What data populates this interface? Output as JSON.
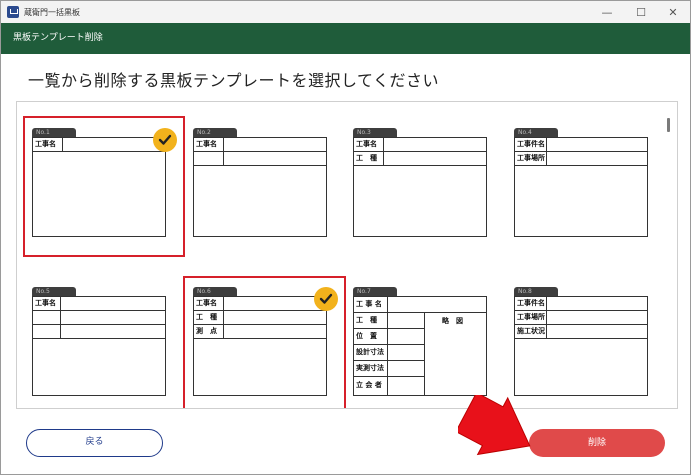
{
  "window": {
    "title": "蔵衛門一括黒板",
    "controls": [
      "—",
      "☐",
      "✕"
    ]
  },
  "header": {
    "title": "黒板テンプレート削除"
  },
  "main": {
    "heading": "一覧から削除する黒板テンプレートを選択してください"
  },
  "templates": [
    {
      "no": "No.1",
      "selected": true,
      "rows": [
        "工事名"
      ]
    },
    {
      "no": "No.2",
      "selected": false,
      "rows": [
        "工事名"
      ]
    },
    {
      "no": "No.3",
      "selected": false,
      "rows": [
        "工事名",
        "工　種"
      ]
    },
    {
      "no": "No.4",
      "selected": false,
      "rows": [
        "工事件名",
        "工事場所"
      ]
    },
    {
      "no": "No.5",
      "selected": false,
      "rows": [
        "工事名"
      ]
    },
    {
      "no": "No.6",
      "selected": true,
      "rows": [
        "工事名",
        "工　種",
        "測　点"
      ]
    },
    {
      "no": "No.7",
      "selected": false,
      "rows": [
        "工 事 名",
        "工　種",
        "位　置",
        "設計寸法",
        "実測寸法",
        "立 会 者"
      ],
      "figure_label": "略　図"
    },
    {
      "no": "No.8",
      "selected": false,
      "rows": [
        "工事件名",
        "工事場所",
        "施工状況"
      ]
    }
  ],
  "footer": {
    "back_label": "戻る",
    "delete_label": "削除"
  },
  "colors": {
    "header_green": "#1f5c3a",
    "select_red": "#d6202a",
    "check_yellow": "#f2b21c",
    "delete_red": "#e04a4a",
    "back_blue": "#1f3a8a"
  }
}
